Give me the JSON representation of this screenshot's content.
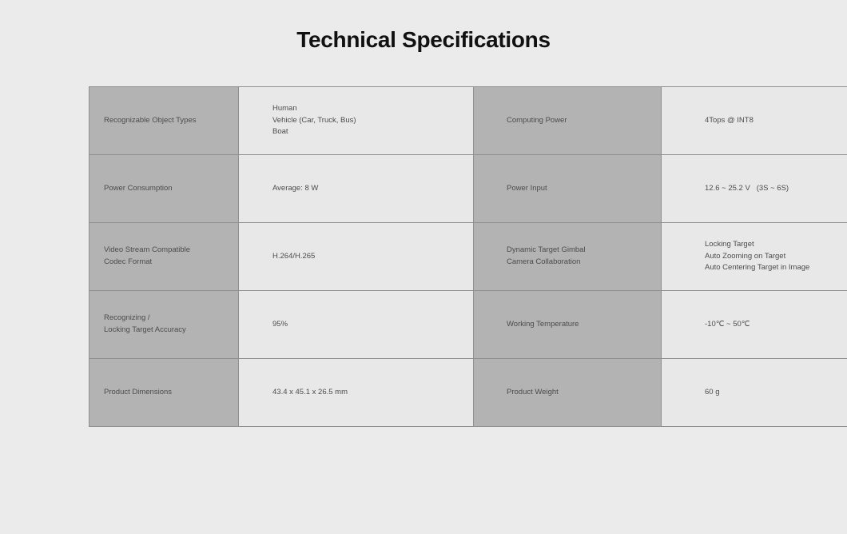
{
  "title": "Technical Specifications",
  "colors": {
    "background": "#ebebeb",
    "label_cell": "#b3b3b3",
    "value_cell": "#e8e8e8",
    "border": "#8f8f8f",
    "title_text": "#111111",
    "body_text": "#4c4c4c"
  },
  "table": {
    "rows": [
      {
        "label_a": "Recognizable Object Types",
        "value_a": [
          "Human",
          "Vehicle (Car, Truck, Bus)",
          "Boat"
        ],
        "label_b": "Computing Power",
        "value_b": [
          "4Tops @ INT8"
        ]
      },
      {
        "label_a": "Power Consumption",
        "value_a": [
          "Average: 8 W"
        ],
        "label_b": "Power Input",
        "value_b": [
          "12.6 ~ 25.2 V   (3S ~ 6S)"
        ]
      },
      {
        "label_a": "Video Stream Compatible\nCodec Format",
        "value_a": [
          "H.264/H.265"
        ],
        "label_b": "Dynamic Target Gimbal\nCamera Collaboration",
        "value_b": [
          "Locking Target",
          "Auto Zooming on Target",
          "Auto Centering Target in Image"
        ]
      },
      {
        "label_a": "Recognizing /\nLocking Target Accuracy",
        "value_a": [
          "95%"
        ],
        "label_b": "Working Temperature",
        "value_b": [
          "-10℃ ~ 50℃"
        ]
      },
      {
        "label_a": "Product Dimensions",
        "value_a": [
          "43.4 x 45.1 x 26.5 mm"
        ],
        "label_b": "Product Weight",
        "value_b": [
          "60 g"
        ]
      }
    ]
  }
}
